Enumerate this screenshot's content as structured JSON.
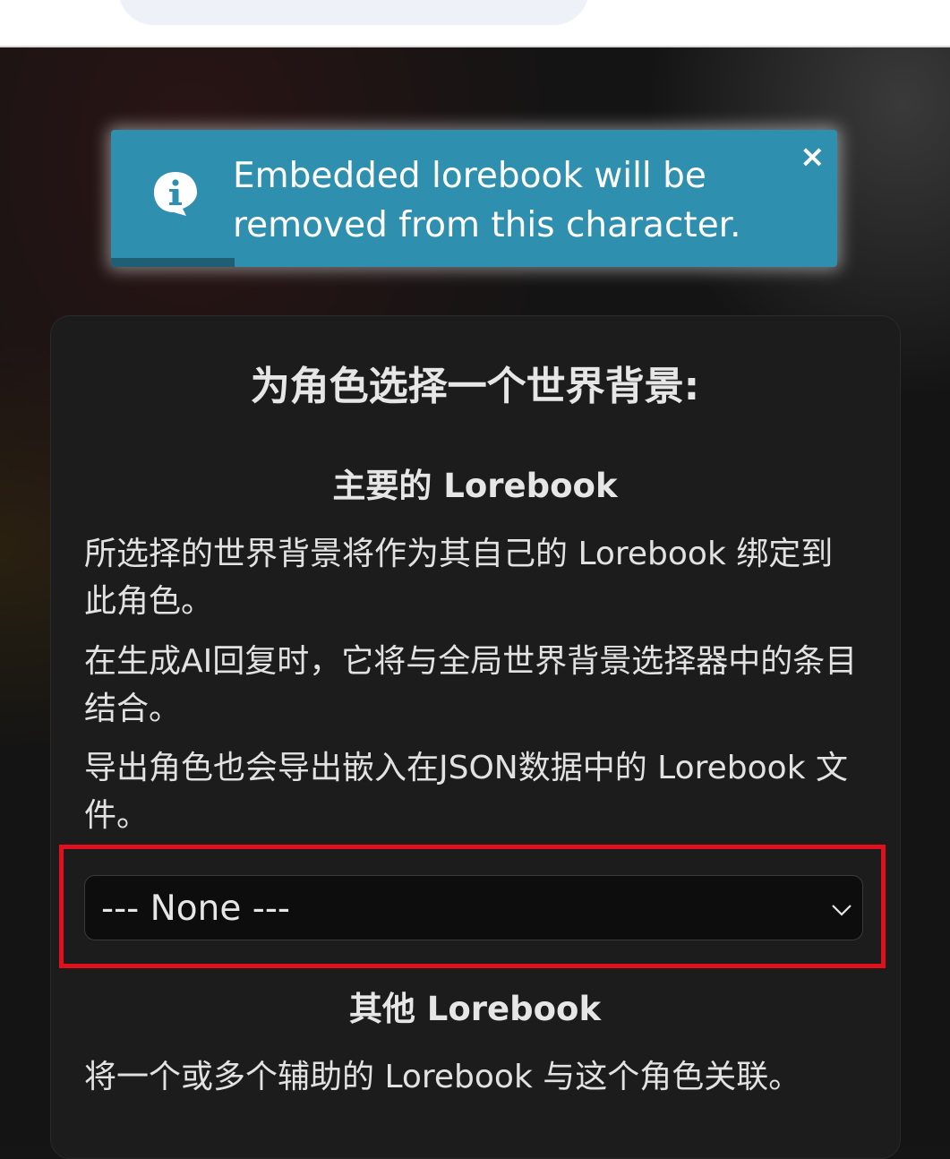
{
  "toast": {
    "message": "Embedded lorebook will be removed from this character.",
    "progress_percent": 17,
    "icon": "info-icon",
    "close_icon": "close-icon",
    "color": "#2f8fae"
  },
  "panel": {
    "title": "为角色选择一个世界背景:",
    "primary": {
      "heading": "主要的 Lorebook",
      "paragraphs": [
        "所选择的世界背景将作为其自己的 Lorebook 绑定到此角色。",
        "在生成AI回复时，它将与全局世界背景选择器中的条目结合。",
        "导出角色也会导出嵌入在JSON数据中的 Lorebook 文件。"
      ],
      "select_value": "--- None ---",
      "select_icon": "chevron-down-icon"
    },
    "other": {
      "heading": "其他 Lorebook",
      "paragraph": "将一个或多个辅助的 Lorebook 与这个角色关联。"
    }
  },
  "highlight_color": "#e0101c"
}
